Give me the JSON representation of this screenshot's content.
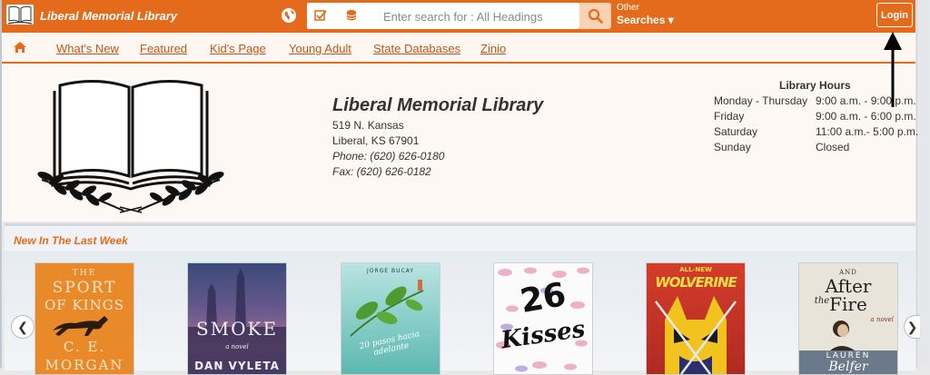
{
  "header": {
    "title": "Liberal Memorial Library",
    "search_placeholder": "Enter search for : All Headings",
    "other_label": "Other",
    "searches_label": "Searches ▾",
    "login_label": "Login",
    "brand_color": "#e46b1c"
  },
  "nav": {
    "items": [
      "What's New",
      "Featured",
      "Kid's Page",
      "Young Adult",
      "State Databases",
      "Zinio"
    ]
  },
  "library": {
    "name": "Liberal Memorial Library",
    "address1": "519 N. Kansas",
    "address2": "Liberal, KS  67901",
    "phone": "Phone: (620) 626-0180",
    "fax": "Fax: (620) 626-0182"
  },
  "hours": {
    "title": "Library Hours",
    "rows": [
      {
        "day": "Monday - Thursday",
        "time": "9:00 a.m. - 9:00 p.m."
      },
      {
        "day": "Friday",
        "time": "9:00 a.m. - 6:00 p.m."
      },
      {
        "day": "Saturday",
        "time": "11:00 a.m.- 5:00 p.m."
      },
      {
        "day": "Sunday",
        "time": "Closed"
      }
    ]
  },
  "new_books": {
    "title": "New In The Last Week",
    "covers": [
      {
        "line1": "THE",
        "line2": "SPORT",
        "line3": "OF KINGS",
        "line4": "C. E.",
        "line5": "MORGAN"
      },
      {
        "line1": "SMOKE",
        "line2": "a novel",
        "line3": "DAN VYLETA"
      },
      {
        "line1": "JORGE BUCAY",
        "line2": "20 pasos hacia adelante"
      },
      {
        "line1": "26",
        "line2": "Kisses"
      },
      {
        "line1": "ALL-NEW",
        "line2": "WOLVERINE"
      },
      {
        "line1": "AND",
        "line2": "After",
        "line3": "the",
        "line4": "Fire",
        "line5": "a novel",
        "line6": "LAUREN",
        "line7": "Belfer"
      }
    ]
  }
}
